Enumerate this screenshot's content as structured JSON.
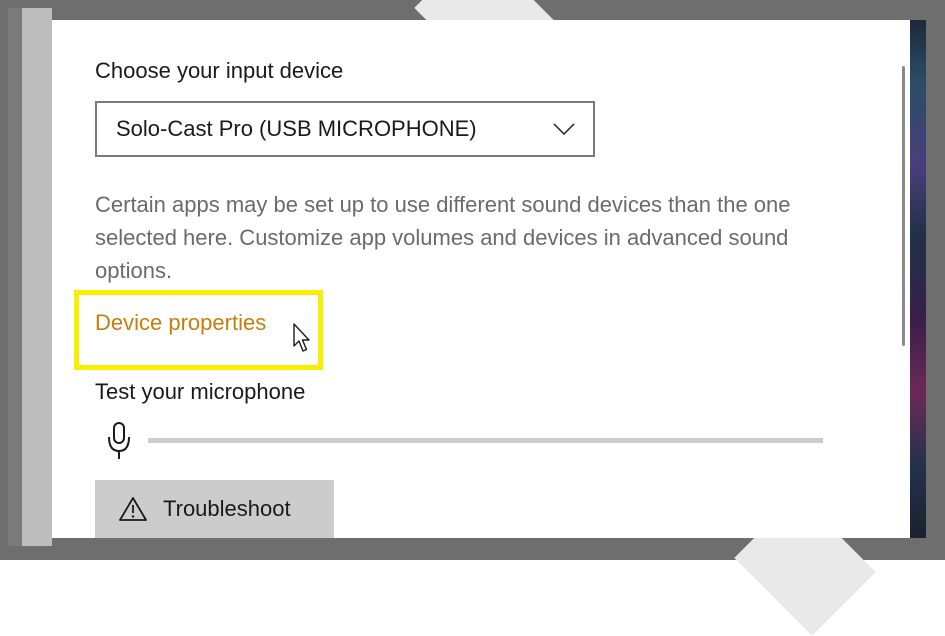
{
  "input_device": {
    "heading": "Choose your input device",
    "selected": "Solo-Cast Pro (USB MICROPHONE)"
  },
  "info": {
    "text": "Certain apps may be set up to use different sound devices than the one selected here. Customize app volumes and devices in advanced sound options."
  },
  "device_properties": {
    "label": "Device properties",
    "highlight_color": "#f7ee00",
    "link_color": "#c87d0a"
  },
  "test_microphone": {
    "heading": "Test your microphone",
    "level": 0
  },
  "troubleshoot": {
    "label": "Troubleshoot",
    "icon": "warning-triangle-icon"
  },
  "icons": {
    "dropdown": "chevron-down-icon",
    "microphone": "microphone-icon",
    "pointer": "mouse-pointer-icon"
  }
}
